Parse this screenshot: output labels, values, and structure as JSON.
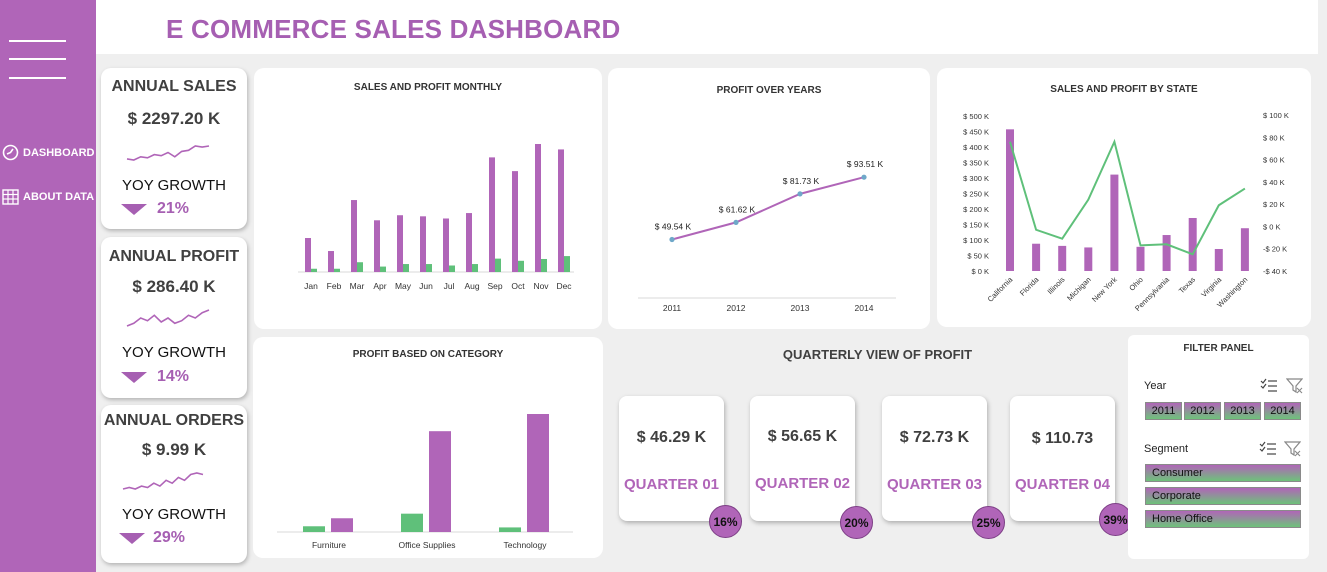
{
  "title": "E COMMERCE SALES DASHBOARD",
  "nav": {
    "dashboard": "DASHBOARD",
    "about": "ABOUT DATA"
  },
  "kpis": [
    {
      "title": "ANNUAL SALES",
      "value": "$ 2297.20 K",
      "growth_label": "YOY GROWTH",
      "growth": "21%",
      "spark": [
        3,
        2.5,
        4,
        3.5,
        5,
        4.5,
        6,
        4,
        6.5,
        7,
        9,
        8.5,
        9
      ]
    },
    {
      "title": "ANNUAL PROFIT",
      "value": "$ 286.40 K",
      "growth_label": "YOY GROWTH",
      "growth": "14%",
      "spark": [
        2,
        3,
        5,
        4,
        6,
        3.5,
        5,
        3,
        4,
        6,
        5,
        7,
        8
      ]
    },
    {
      "title": "ANNUAL ORDERS",
      "value": "$ 9.99 K",
      "growth_label": "YOY GROWTH",
      "growth": "29%",
      "spark": [
        2,
        2.5,
        2,
        3,
        2.5,
        4,
        3,
        5,
        4,
        6,
        5,
        7,
        7.5,
        7
      ]
    }
  ],
  "charts": {
    "monthly_title": "SALES AND PROFIT MONTHLY",
    "years_title": "PROFIT OVER YEARS",
    "state_title": "SALES AND PROFIT BY STATE",
    "category_title": "PROFIT BASED ON CATEGORY"
  },
  "chart_data": [
    {
      "type": "bar",
      "title": "SALES AND PROFIT MONTHLY",
      "categories": [
        "Jan",
        "Feb",
        "Mar",
        "Apr",
        "May",
        "Jun",
        "Jul",
        "Aug",
        "Sep",
        "Oct",
        "Nov",
        "Dec"
      ],
      "series": [
        {
          "values": [
            94,
            58,
            199,
            143,
            157,
            154,
            148,
            163,
            317,
            279,
            354,
            339
          ]
        },
        {
          "values": [
            9,
            9,
            27,
            15,
            22,
            22,
            18,
            22,
            37,
            31,
            36,
            44
          ]
        }
      ]
    },
    {
      "type": "line",
      "title": "PROFIT OVER YEARS",
      "x": [
        "2011",
        "2012",
        "2013",
        "2014"
      ],
      "y": [
        49.54,
        61.62,
        81.73,
        93.51
      ],
      "labels": [
        "$ 49.54 K",
        "$ 61.62 K",
        "$ 81.73 K",
        "$ 93.51 K"
      ]
    },
    {
      "type": "bar",
      "title": "SALES AND PROFIT BY STATE",
      "categories": [
        "California",
        "Florida",
        "Illinois",
        "Michigan",
        "New York",
        "Ohio",
        "Pennsylvania",
        "Texas",
        "Virginia",
        "Washington"
      ],
      "y_ticks": [
        "$ 500 K",
        "$ 450 K",
        "$ 400 K",
        "$ 350 K",
        "$ 300 K",
        "$ 250 K",
        "$ 200 K",
        "$ 150 K",
        "$ 100 K",
        "$ 50 K",
        "$ 0 K"
      ],
      "y2_ticks": [
        "$ 100 K",
        "$ 80 K",
        "$ 60 K",
        "$ 40 K",
        "$ 20 K",
        "$ 0 K",
        "-$ 20 K",
        "-$ 40 K"
      ],
      "ylim": [
        0,
        500
      ],
      "y2lim": [
        -40,
        100
      ],
      "series": [
        {
          "values": [
            457,
            88,
            81,
            76,
            311,
            78,
            116,
            171,
            71,
            138
          ]
        },
        {
          "values": [
            76,
            -3,
            -11,
            24,
            76,
            -17,
            -16,
            -25,
            19,
            34
          ]
        }
      ]
    },
    {
      "type": "bar",
      "title": "PROFIT BASED ON CATEGORY",
      "categories": [
        "Furniture",
        "Office Supplies",
        "Technology"
      ],
      "series": [
        {
          "values": [
            5,
            16,
            4
          ]
        },
        {
          "values": [
            12,
            88,
            103
          ]
        }
      ]
    }
  ],
  "quarterly": {
    "title": "QUARTERLY VIEW OF PROFIT",
    "cards": [
      {
        "value": "$ 46.29 K",
        "label": "QUARTER 01",
        "pct": "16%"
      },
      {
        "value": "$ 56.65 K",
        "label": "QUARTER 02",
        "pct": "20%"
      },
      {
        "value": "$ 72.73 K",
        "label": "QUARTER 03",
        "pct": "25%"
      },
      {
        "value": "$ 110.73",
        "label": "QUARTER 04",
        "pct": "39%"
      }
    ]
  },
  "filter": {
    "title": "FILTER PANEL",
    "year_label": "Year",
    "years": [
      "2011",
      "2012",
      "2013",
      "2014"
    ],
    "segment_label": "Segment",
    "segments": [
      "Consumer",
      "Corporate",
      "Home Office"
    ]
  },
  "colors": {
    "purple": "#b065b8",
    "green": "#5fc07a"
  }
}
